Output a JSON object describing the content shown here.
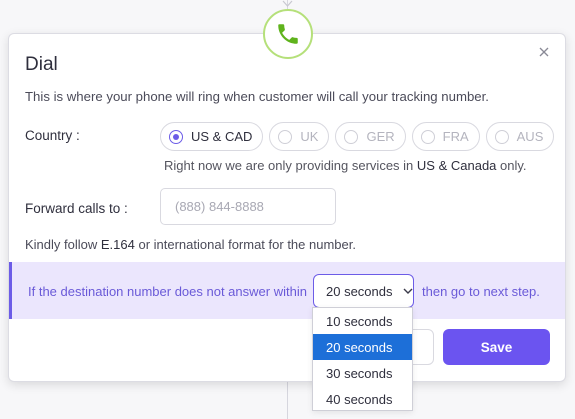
{
  "modal": {
    "title": "Dial",
    "description": "This is where your phone will ring when customer will call your tracking number.",
    "country_label": "Country :",
    "countries": [
      {
        "label": "US & CAD",
        "selected": true
      },
      {
        "label": "UK",
        "selected": false
      },
      {
        "label": "GER",
        "selected": false
      },
      {
        "label": "FRA",
        "selected": false
      },
      {
        "label": "AUS",
        "selected": false
      }
    ],
    "note_prefix": "Right now we are only providing services in ",
    "note_bold": "US & Canada",
    "note_suffix": " only.",
    "forward_label": "Forward calls to :",
    "phone_placeholder": "(888) 844-8888",
    "phone_value": "",
    "hint_prefix": "Kindly follow ",
    "hint_bold": "E.164",
    "hint_suffix": " or international format for the number.",
    "timeout_prefix": "If the destination number does not answer within",
    "timeout_selected": "20 seconds",
    "timeout_suffix": "then go to next step.",
    "timeout_options": [
      "10 seconds",
      "20 seconds",
      "30 seconds",
      "40 seconds"
    ],
    "save_label": "Save",
    "cancel_label": ""
  },
  "colors": {
    "accent": "#6c5ce7",
    "band": "#ebe6fd",
    "node_border": "#b5e07a",
    "phone_icon": "#5fb31c",
    "dropdown_selected": "#1d6fd8"
  },
  "icons": {
    "node": "phone-icon",
    "close": "close-icon",
    "select": "chevron-down-icon"
  }
}
